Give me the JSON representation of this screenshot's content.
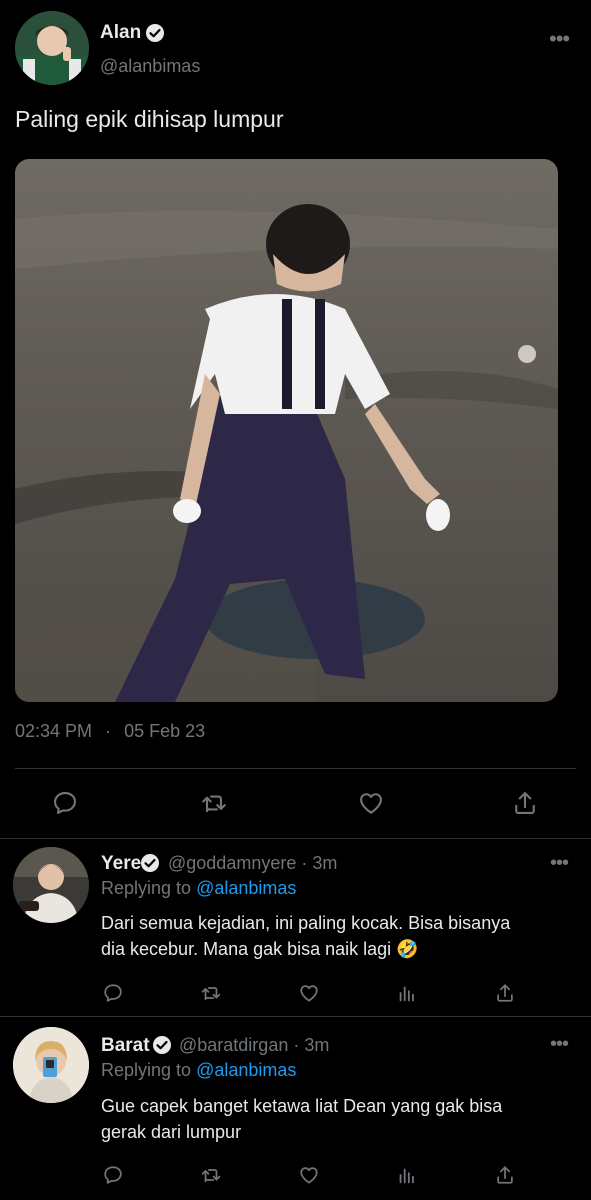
{
  "main_tweet": {
    "author_name": "Alan",
    "author_handle": "@alanbimas",
    "text": "Paling epik dihisap lumpur",
    "time": "02:34 PM",
    "date": "05 Feb 23",
    "more_icon": "more-horizontal-icon",
    "actions": [
      "reply-icon",
      "retweet-icon",
      "like-icon",
      "share-icon"
    ]
  },
  "replies": [
    {
      "author_name": "Yere",
      "author_handle": "@goddamnyere",
      "age": "· 3m",
      "replying_prefix": "Replying to",
      "replying_to": "@alanbimas",
      "text_line1": "Dari semua kejadian, ini paling kocak. Bisa bisanya",
      "text_line2": "dia kecebur. Mana gak bisa naik lagi 🤣"
    },
    {
      "author_name": "Barat",
      "author_handle": "@baratdirgan",
      "age": "· 3m",
      "replying_prefix": "Replying to",
      "replying_to": "@alanbimas",
      "text_line1": "Gue capek banget ketawa liat Dean yang gak bisa",
      "text_line2": "gerak dari lumpur"
    }
  ],
  "colors": {
    "background": "#000000",
    "text": "#e7e9ea",
    "muted": "#71767b",
    "link": "#1d9bf0",
    "divider": "#2f3336"
  }
}
